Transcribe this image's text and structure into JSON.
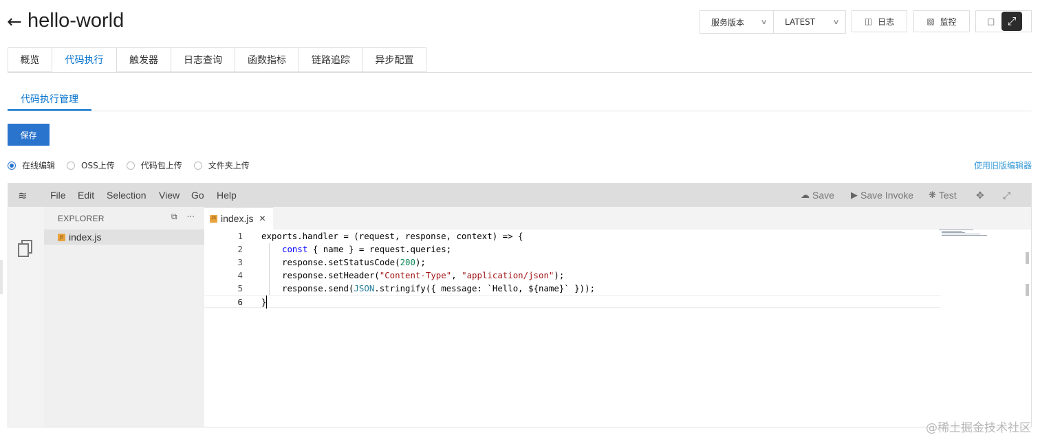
{
  "header": {
    "back_icon": "arrow-left",
    "title": "hello-world",
    "version_label": "服务版本",
    "version_value": "LATEST",
    "buttons": [
      {
        "label": "日志",
        "icon": "log-icon"
      },
      {
        "label": "监控",
        "icon": "chart-icon"
      }
    ]
  },
  "tabs": [
    "概览",
    "代码执行",
    "触发器",
    "日志查询",
    "函数指标",
    "链路追踪",
    "异步配置"
  ],
  "active_tab": "代码执行",
  "subtab": "代码执行管理",
  "save_button": "保存",
  "radios": [
    {
      "label": "在线编辑",
      "checked": true
    },
    {
      "label": "OSS上传",
      "checked": false
    },
    {
      "label": "代码包上传",
      "checked": false
    },
    {
      "label": "文件夹上传",
      "checked": false
    }
  ],
  "old_editor_link": "使用旧版编辑器",
  "ide": {
    "menus": [
      "File",
      "Edit",
      "Selection",
      "View",
      "Go",
      "Help"
    ],
    "tools": [
      {
        "label": "Save",
        "icon": "cloud-upload-icon"
      },
      {
        "label": "Save Invoke",
        "icon": "play-icon"
      },
      {
        "label": "Test",
        "icon": "bug-icon"
      }
    ],
    "explorer_title": "EXPLORER",
    "files": [
      "index.js"
    ],
    "open_tab": "index.js",
    "line_numbers": [
      "1",
      "2",
      "3",
      "4",
      "5",
      "6"
    ],
    "code": {
      "l1": "exports.handler = (request, response, context) => {",
      "l2_kw": "const",
      "l2_rest": " { name } = request.queries;",
      "l3_a": "response.setStatusCode(",
      "l3_num": "200",
      "l3_b": ");",
      "l4_a": "response.setHeader(",
      "l4_s1": "\"Content-Type\"",
      "l4_mid": ", ",
      "l4_s2": "\"application/json\"",
      "l4_b": ");",
      "l5_a": "response.send(",
      "l5_cls": "JSON",
      "l5_b": ".stringify({ message: `Hello, ${name}` }));",
      "l6": "}"
    }
  },
  "watermark": "@稀土掘金技术社区",
  "colors": {
    "accent": "#0070cc",
    "primary_button": "#2b74cd",
    "link": "#3a9bd9"
  }
}
